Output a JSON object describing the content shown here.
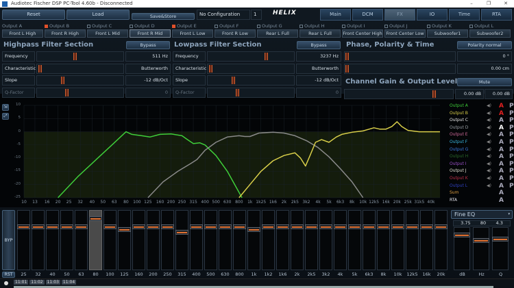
{
  "window": {
    "title": "Audiotec Fischer DSP PC-Tool 4.60b - Disconnected",
    "minimize": "–",
    "maximize": "❐",
    "close": "✕"
  },
  "toolbar": {
    "reset": "Reset",
    "load": "Load",
    "save_store": "Save&Store",
    "configuration": "No Configuration",
    "config_number": "1",
    "logo": "HELIX"
  },
  "tabs": [
    {
      "label": "Main"
    },
    {
      "label": "DCM"
    },
    {
      "label": "FX",
      "active": true
    },
    {
      "label": "IO"
    },
    {
      "label": "Time"
    },
    {
      "label": "RTA"
    }
  ],
  "outputs": [
    {
      "label": "Output A",
      "checked": false,
      "name": "Front L High"
    },
    {
      "label": "Output B",
      "checked": true,
      "name": "Front R High"
    },
    {
      "label": "Output C",
      "checked": false,
      "name": "Front L Mid"
    },
    {
      "label": "Output D",
      "checked": false,
      "name": "Front R Mid",
      "selected": true
    },
    {
      "label": "Output E",
      "checked": true,
      "name": "Front L Low"
    },
    {
      "label": "Output F",
      "checked": false,
      "name": "Front R Low"
    },
    {
      "label": "Output G",
      "checked": false,
      "name": "Rear L Full"
    },
    {
      "label": "Output H",
      "checked": false,
      "name": "Rear L Full"
    },
    {
      "label": "Output I",
      "checked": false,
      "name": "Front Center High"
    },
    {
      "label": "Output J",
      "checked": false,
      "name": "Front Center Low"
    },
    {
      "label": "Output K",
      "checked": false,
      "name": "Subwoofer1"
    },
    {
      "label": "Output L",
      "checked": false,
      "name": "Subwoofer2"
    }
  ],
  "highpass": {
    "title": "Highpass Filter Section",
    "bypass": "Bypass",
    "rows": [
      {
        "label": "Frequency",
        "value": "511 Hz",
        "pos": 0.45
      },
      {
        "label": "Characteristic",
        "value": "Butterworth",
        "pos": 0.02
      },
      {
        "label": "Slope",
        "value": "-12 dB/Oct",
        "pos": 0.3
      },
      {
        "label": "Q-Factor",
        "value": "0",
        "pos": 0.35,
        "disabled": true
      }
    ]
  },
  "lowpass": {
    "title": "Lowpass Filter Section",
    "bypass": "Bypass",
    "rows": [
      {
        "label": "Frequency",
        "value": "3237 Hz",
        "pos": 0.7
      },
      {
        "label": "Characteristic",
        "value": "Butterworth",
        "pos": 0.02
      },
      {
        "label": "Slope",
        "value": "-12 dB/Oct",
        "pos": 0.3
      },
      {
        "label": "Q-Factor",
        "value": "0",
        "pos": 0.35,
        "disabled": true
      }
    ]
  },
  "phase": {
    "title": "Phase, Polarity & Time",
    "polarity": "Polarity normal",
    "phase_value": "0 °",
    "delay_value": "0.00 cm"
  },
  "gain": {
    "title": "Channel Gain & Output Level",
    "mute": "Mute",
    "gain_value": "0.00 dB",
    "level_value": "0.00 dB",
    "pos": 0.85
  },
  "chart_data": {
    "type": "line",
    "xscale": "log",
    "xlim": [
      10,
      48000
    ],
    "ylim": [
      -25,
      10
    ],
    "x_ticks": [
      "10",
      "13",
      "16",
      "20",
      "25",
      "32",
      "40",
      "50",
      "63",
      "80",
      "100",
      "125",
      "160",
      "200",
      "250",
      "315",
      "400",
      "500",
      "630",
      "800",
      "1k",
      "1k25",
      "1k6",
      "2k",
      "2k5",
      "3k2",
      "4k",
      "5k",
      "6k3",
      "8k",
      "10k",
      "12k5",
      "16k",
      "20k",
      "25k",
      "31k5",
      "40k"
    ],
    "y_ticks": [
      "10",
      "5",
      "0",
      "-5",
      "-10",
      "-15",
      "-20",
      "-25"
    ],
    "series": [
      {
        "name": "Output A",
        "color": "#3fcf3a",
        "points": [
          [
            20,
            -25
          ],
          [
            30,
            -17
          ],
          [
            45,
            -10
          ],
          [
            60,
            -5
          ],
          [
            80,
            0
          ],
          [
            90,
            -1
          ],
          [
            110,
            -1.5
          ],
          [
            130,
            -2
          ],
          [
            160,
            -1
          ],
          [
            200,
            -0.8
          ],
          [
            250,
            -1.5
          ],
          [
            280,
            -3
          ],
          [
            315,
            -4.5
          ],
          [
            360,
            -4.2
          ],
          [
            400,
            -5
          ],
          [
            500,
            -9
          ],
          [
            630,
            -15
          ],
          [
            800,
            -23
          ],
          [
            850,
            -25
          ]
        ]
      },
      {
        "name": "Output C",
        "color": "#8a8a8a",
        "points": [
          [
            125,
            -25
          ],
          [
            170,
            -19
          ],
          [
            230,
            -15
          ],
          [
            300,
            -12
          ],
          [
            340,
            -10.5
          ],
          [
            400,
            -7
          ],
          [
            500,
            -4
          ],
          [
            630,
            -2
          ],
          [
            800,
            -1.5
          ],
          [
            900,
            -1.8
          ],
          [
            1000,
            -1.8
          ],
          [
            1200,
            -0.5
          ],
          [
            1600,
            -0.2
          ],
          [
            2000,
            -0.5
          ],
          [
            2500,
            -1.5
          ],
          [
            3200,
            -3.5
          ],
          [
            4000,
            -6
          ],
          [
            5000,
            -9.5
          ],
          [
            6300,
            -14
          ],
          [
            8000,
            -19
          ],
          [
            10000,
            -25
          ]
        ]
      },
      {
        "name": "Output B",
        "color": "#d9cf4a",
        "points": [
          [
            800,
            -25
          ],
          [
            1000,
            -20
          ],
          [
            1250,
            -15
          ],
          [
            1600,
            -11
          ],
          [
            2000,
            -9
          ],
          [
            2500,
            -8
          ],
          [
            2800,
            -10
          ],
          [
            3100,
            -13
          ],
          [
            3400,
            -9
          ],
          [
            3800,
            -4
          ],
          [
            4300,
            -3
          ],
          [
            5000,
            -4
          ],
          [
            5800,
            -2
          ],
          [
            6500,
            -1
          ],
          [
            8000,
            -0.2
          ],
          [
            10000,
            0.3
          ],
          [
            12500,
            1.5
          ],
          [
            14000,
            1
          ],
          [
            16000,
            1
          ],
          [
            18000,
            2
          ],
          [
            20000,
            3.8
          ],
          [
            22000,
            2
          ],
          [
            25000,
            0.5
          ],
          [
            31500,
            0
          ],
          [
            48000,
            0
          ]
        ]
      }
    ]
  },
  "legend": [
    {
      "label": "Output A",
      "color": "#3fcf3a",
      "a": "#e02020"
    },
    {
      "label": "Output B",
      "color": "#d9cf4a",
      "a": "#e02020"
    },
    {
      "label": "Output C",
      "color": "#e8e8e8",
      "a": "#aab"
    },
    {
      "label": "Output D",
      "color": "#9aa0a6",
      "a": "#ffffff"
    },
    {
      "label": "Output E",
      "color": "#d06a9a",
      "a": "#aab"
    },
    {
      "label": "Output F",
      "color": "#3ab8e0",
      "a": "#aab"
    },
    {
      "label": "Output G",
      "color": "#3a7ae0",
      "a": "#aab"
    },
    {
      "label": "Output H",
      "color": "#2a6a2a",
      "a": "#aab"
    },
    {
      "label": "Output I",
      "color": "#9a50c8",
      "a": "#aab"
    },
    {
      "label": "Output J",
      "color": "#e0e0d0",
      "a": "#aab"
    },
    {
      "label": "Output K",
      "color": "#c0304a",
      "a": "#aab"
    },
    {
      "label": "Output L",
      "color": "#3040c0",
      "a": "#aab"
    },
    {
      "label": "Sum",
      "color": "#e0a040",
      "a": "#aab",
      "noP": true
    },
    {
      "label": "RTA",
      "color": "#e8e8f0",
      "a": "#aab",
      "noP": true
    }
  ],
  "legend_icons": {
    "speaker": "speaker-icon",
    "a": "A",
    "p": "P"
  },
  "eq": {
    "bypass": "BYP",
    "reset": "RST",
    "bands": [
      {
        "f": "25",
        "g": 0
      },
      {
        "f": "32",
        "g": 0
      },
      {
        "f": "40",
        "g": 0
      },
      {
        "f": "50",
        "g": 0
      },
      {
        "f": "63",
        "g": 0
      },
      {
        "f": "80",
        "g": 3,
        "sel": true
      },
      {
        "f": "100",
        "g": 0
      },
      {
        "f": "125",
        "g": -1
      },
      {
        "f": "160",
        "g": 0
      },
      {
        "f": "200",
        "g": 0
      },
      {
        "f": "250",
        "g": 0
      },
      {
        "f": "315",
        "g": -2
      },
      {
        "f": "400",
        "g": 0
      },
      {
        "f": "500",
        "g": 0
      },
      {
        "f": "630",
        "g": 0
      },
      {
        "f": "800",
        "g": 0
      },
      {
        "f": "1k",
        "g": -1
      },
      {
        "f": "1k2",
        "g": 0
      },
      {
        "f": "1k6",
        "g": 0
      },
      {
        "f": "2k",
        "g": 0
      },
      {
        "f": "2k5",
        "g": 0
      },
      {
        "f": "3k2",
        "g": 0
      },
      {
        "f": "4k",
        "g": 0
      },
      {
        "f": "5k",
        "g": 0
      },
      {
        "f": "6k3",
        "g": 0
      },
      {
        "f": "8k",
        "g": 0
      },
      {
        "f": "10k",
        "g": 0
      },
      {
        "f": "12k5",
        "g": 0
      },
      {
        "f": "16k",
        "g": 0
      },
      {
        "f": "20k",
        "g": 0
      }
    ]
  },
  "fine_eq": {
    "mode": "Fine EQ",
    "db": "3.75",
    "hz": "80",
    "q": "4.3",
    "db_label": "dB",
    "hz_label": "Hz",
    "q_label": "Q"
  },
  "timeline": [
    "11:01",
    "11:02",
    "11:03",
    "11:04"
  ]
}
